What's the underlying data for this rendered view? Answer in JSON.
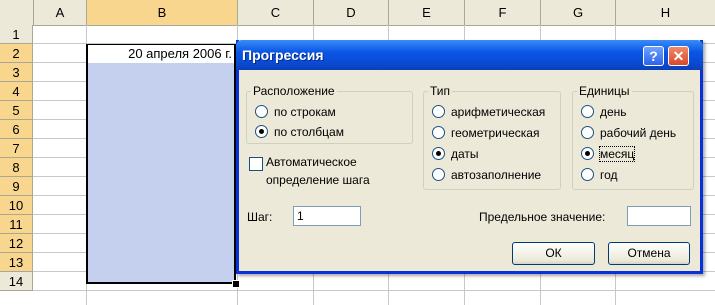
{
  "sheet": {
    "columns": [
      "A",
      "B",
      "C",
      "D",
      "E",
      "F",
      "G",
      "H"
    ],
    "selected_column": "B",
    "rows": [
      "1",
      "2",
      "3",
      "4",
      "5",
      "6",
      "7",
      "8",
      "9",
      "10",
      "11",
      "12",
      "13",
      "14"
    ],
    "selected_rows": [
      "2",
      "3",
      "4",
      "5",
      "6",
      "7",
      "8",
      "9",
      "10",
      "11",
      "12",
      "13"
    ],
    "active_cell": {
      "ref": "B2",
      "value": "20 апреля 2006 г."
    }
  },
  "dialog": {
    "title": "Прогрессия",
    "help_icon": "question-mark-icon",
    "close_icon": "close-icon",
    "location": {
      "legend": "Расположение",
      "options": [
        {
          "label": "по строкам",
          "selected": false
        },
        {
          "label": "по столбцам",
          "selected": true
        }
      ]
    },
    "type": {
      "legend": "Тип",
      "options": [
        {
          "label": "арифметическая",
          "selected": false
        },
        {
          "label": "геометрическая",
          "selected": false
        },
        {
          "label": "даты",
          "selected": true
        },
        {
          "label": "автозаполнение",
          "selected": false
        }
      ]
    },
    "units": {
      "legend": "Единицы",
      "options": [
        {
          "label": "день",
          "selected": false
        },
        {
          "label": "рабочий день",
          "selected": false
        },
        {
          "label": "месяц",
          "selected": true
        },
        {
          "label": "год",
          "selected": false
        }
      ]
    },
    "auto_step": {
      "line1": "Автоматическое",
      "line2": "определение шага",
      "checked": false
    },
    "step": {
      "label": "Шаг:",
      "value": "1"
    },
    "limit": {
      "label": "Предельное значение:",
      "value": ""
    },
    "ok_label": "ОК",
    "cancel_label": "Отмена"
  },
  "colors": {
    "selection": "#c5cfee",
    "header_selected": "#f9d68e",
    "titlebar": "#0a56e6"
  }
}
